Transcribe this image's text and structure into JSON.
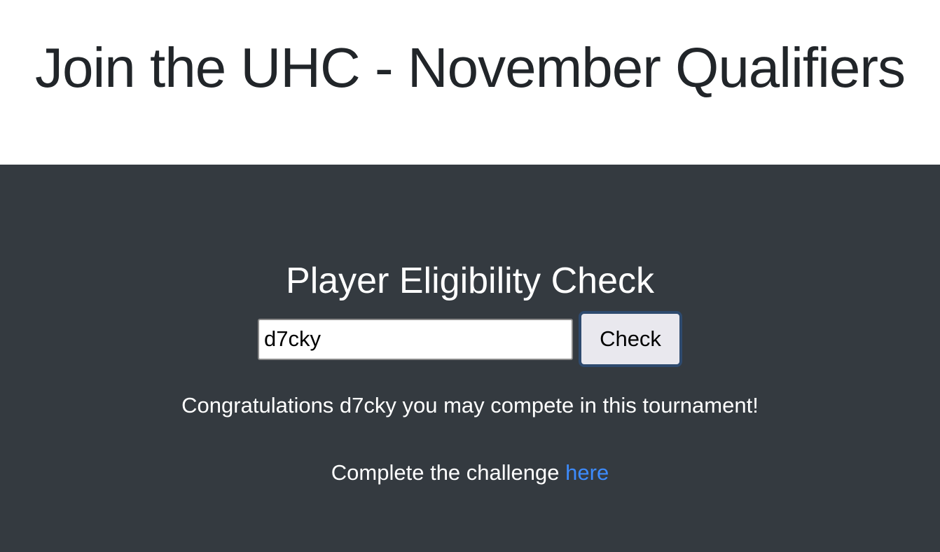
{
  "header": {
    "title": "Join the UHC - November Qualifiers"
  },
  "main": {
    "heading": "Player Eligibility Check",
    "form": {
      "input_value": "d7cky",
      "button_label": "Check"
    },
    "result_message": "Congratulations d7cky you may compete in this tournament!",
    "challenge": {
      "text": "Complete the challenge",
      "link_label": "here"
    }
  },
  "colors": {
    "header_bg": "#ffffff",
    "title_text": "#212529",
    "main_bg": "#343a40",
    "main_text": "#ffffff",
    "link": "#3d8bfd",
    "button_bg": "#e9e8ee",
    "button_focus_border": "#2e4a6e"
  }
}
